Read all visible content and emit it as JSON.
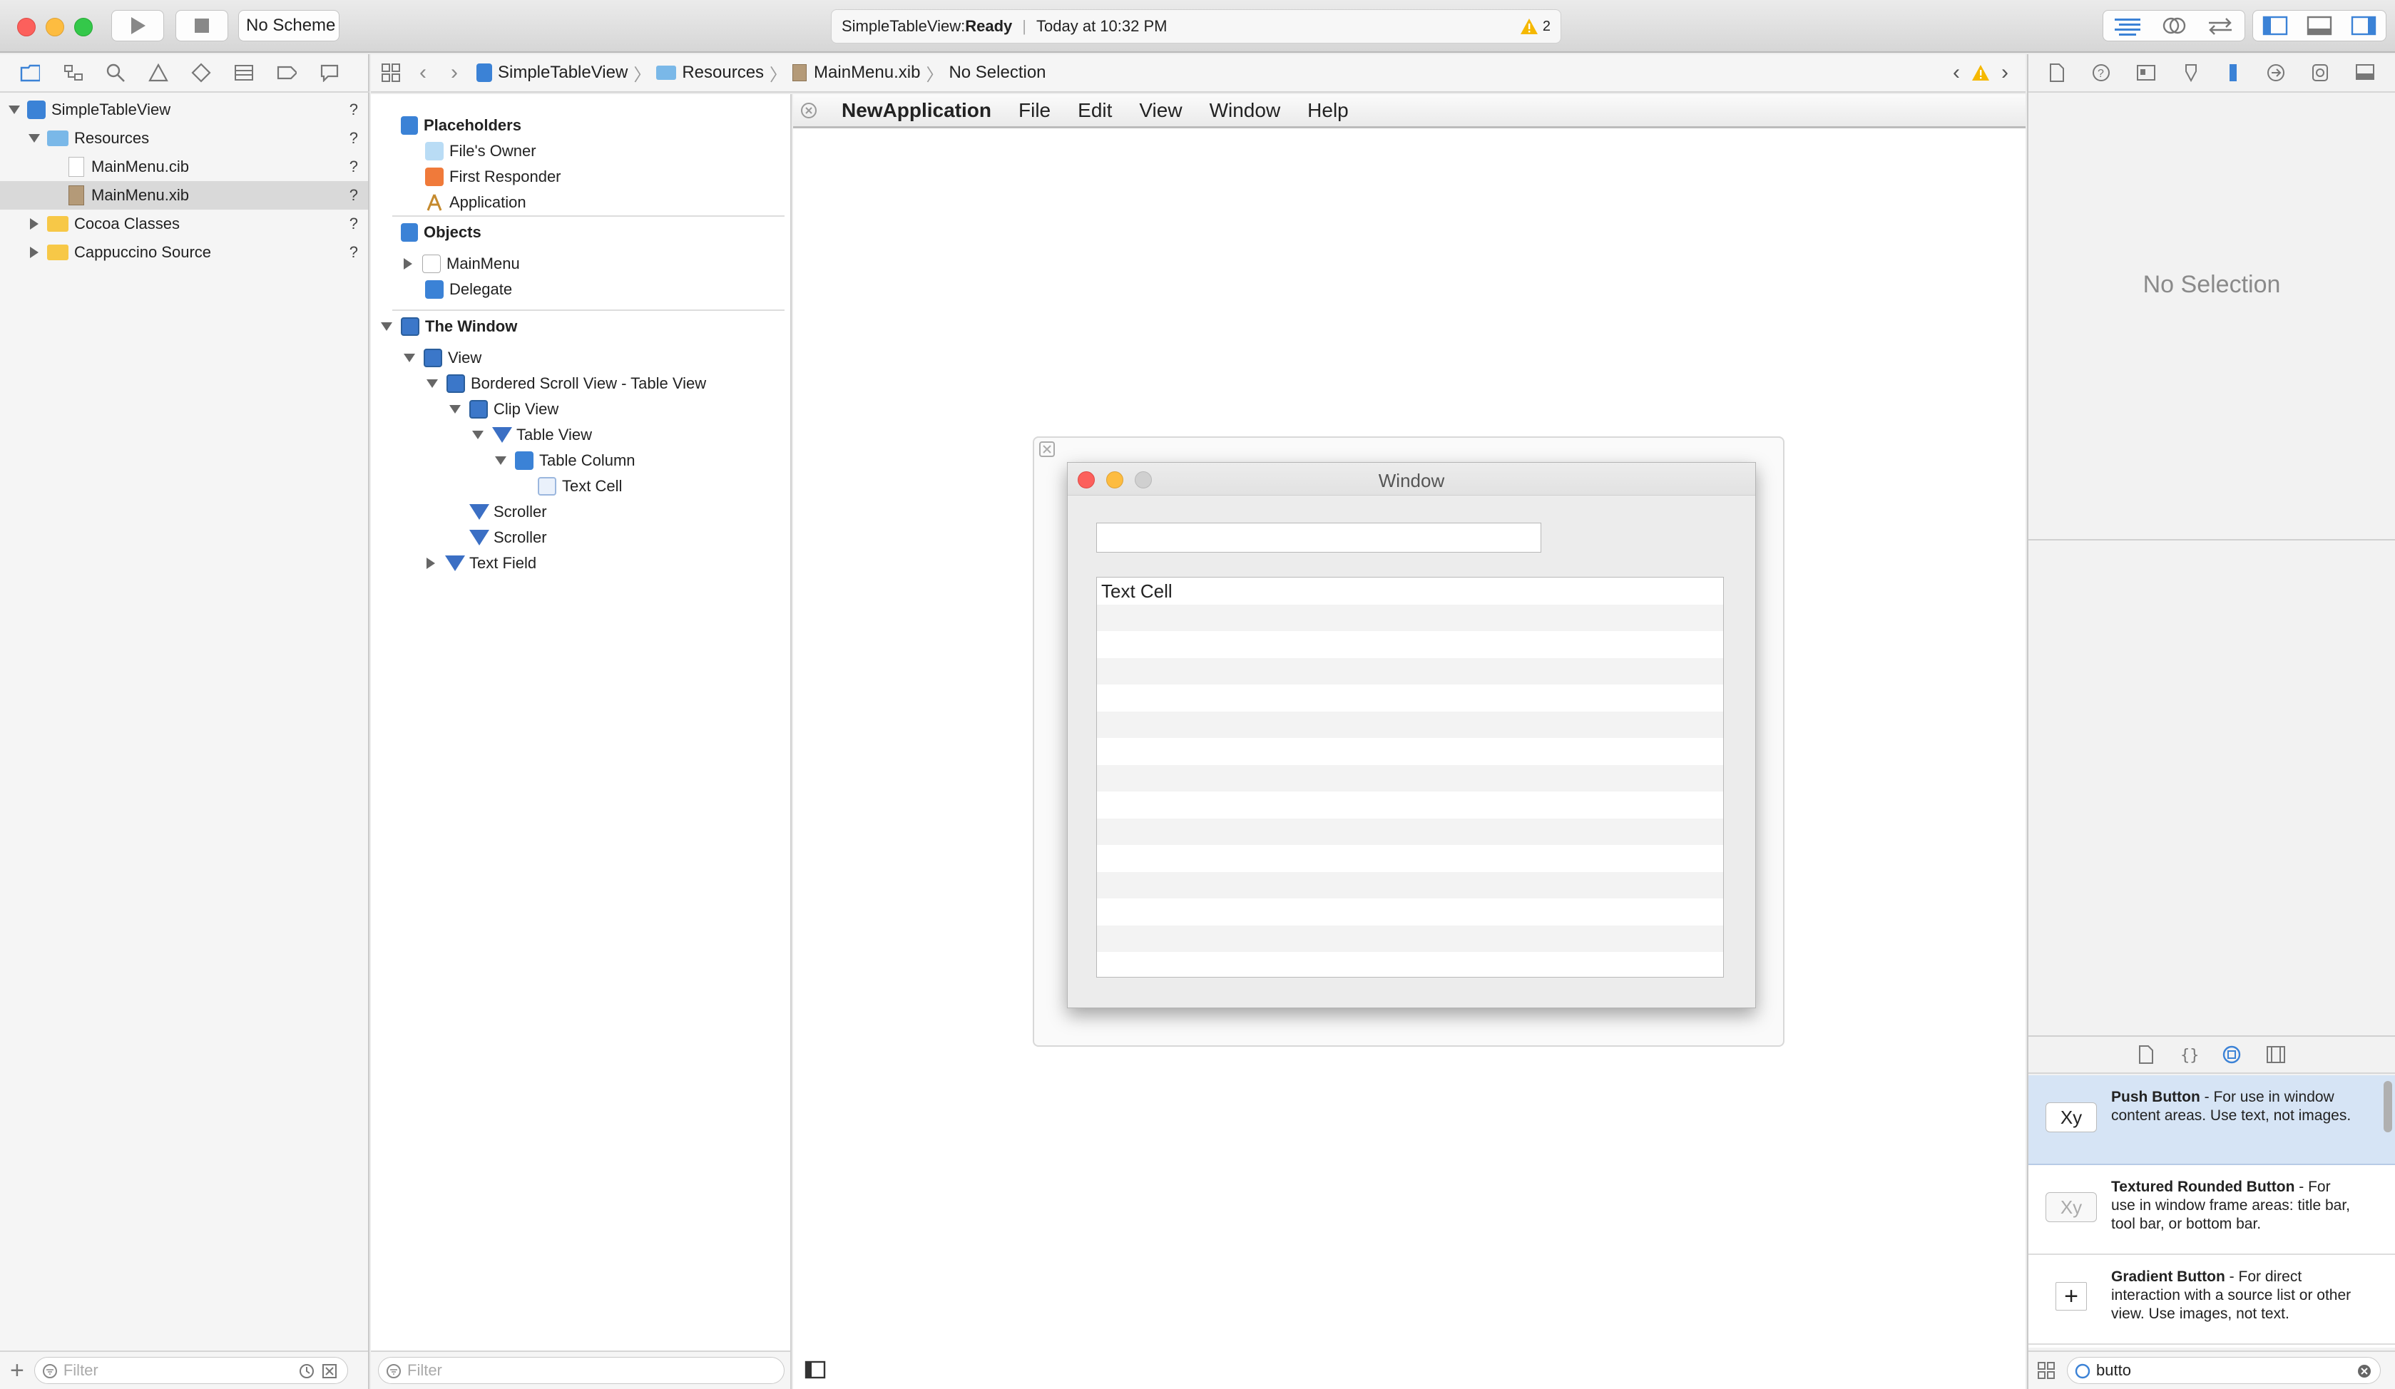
{
  "toolbar": {
    "scheme": "No Scheme",
    "status_project": "SimpleTableView: ",
    "status_state": "Ready",
    "status_time": "Today at 10:32 PM",
    "warning_count": "2"
  },
  "navigator": {
    "items": [
      {
        "label": "SimpleTableView",
        "mark": "?"
      },
      {
        "label": "Resources",
        "mark": "?"
      },
      {
        "label": "MainMenu.cib",
        "mark": "?"
      },
      {
        "label": "MainMenu.xib",
        "mark": "?"
      },
      {
        "label": "Cocoa Classes",
        "mark": "?"
      },
      {
        "label": "Cappuccino Source",
        "mark": "?"
      }
    ],
    "filter_placeholder": "Filter"
  },
  "jumpbar": {
    "crumbs": [
      "SimpleTableView",
      "Resources",
      "MainMenu.xib",
      "No Selection"
    ]
  },
  "outline": {
    "placeholders": "Placeholders",
    "files_owner": "File's Owner",
    "first_responder": "First Responder",
    "application": "Application",
    "objects": "Objects",
    "mainmenu": "MainMenu",
    "delegate": "Delegate",
    "the_window": "The Window",
    "view": "View",
    "bordered_scroll": "Bordered Scroll View - Table View",
    "clip_view": "Clip View",
    "table_view": "Table View",
    "table_column": "Table Column",
    "text_cell": "Text Cell",
    "scroller1": "Scroller",
    "scroller2": "Scroller",
    "text_field": "Text Field",
    "filter_placeholder": "Filter"
  },
  "canvas": {
    "menu": {
      "app": "NewApplication",
      "items": [
        "File",
        "Edit",
        "View",
        "Window",
        "Help"
      ]
    },
    "window_title": "Window",
    "table_first_cell": "Text Cell"
  },
  "inspector": {
    "empty": "No Selection"
  },
  "library": {
    "items": [
      {
        "title": "Push Button",
        "desc": " - For use in window content areas. Use text, not images.",
        "icon": "Xy"
      },
      {
        "title": "Textured Rounded Button",
        "desc": " - For use in window frame areas: title bar, tool bar, or bottom bar.",
        "icon": "Xy"
      },
      {
        "title": "Gradient Button",
        "desc": " - For direct interaction with a source list or other view. Use images, not text.",
        "icon": "+"
      }
    ],
    "search_value": "butto"
  },
  "colors": {
    "selection": "#d9d9d9",
    "accent": "#3b82d6",
    "warning": "#f5b800"
  }
}
